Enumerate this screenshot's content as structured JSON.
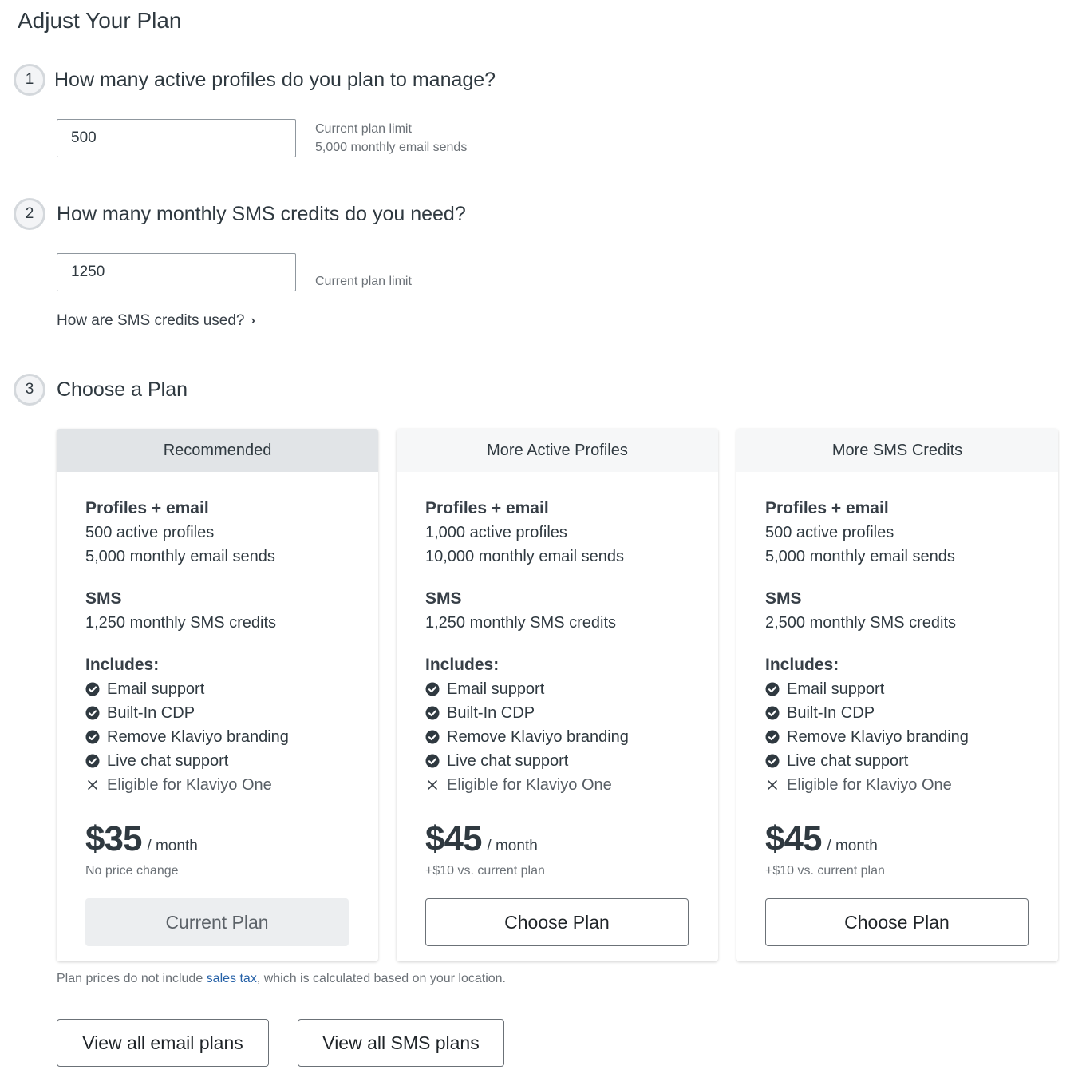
{
  "page": {
    "title": "Adjust Your Plan"
  },
  "steps": [
    {
      "number": "1",
      "title": "How many active profiles do you plan to manage?"
    },
    {
      "number": "2",
      "title": "How many monthly SMS credits do you need?"
    },
    {
      "number": "3",
      "title": "Choose a Plan"
    }
  ],
  "profiles_input": {
    "value": "500",
    "hint_line1": "Current plan limit",
    "hint_line2": "5,000 monthly email sends"
  },
  "sms_input": {
    "value": "1250",
    "hint_line1": "Current plan limit"
  },
  "sms_link": {
    "label": "How are SMS credits used?",
    "icon": "chevron-right-icon",
    "glyph": "›"
  },
  "plans": [
    {
      "header": "Recommended",
      "profiles_title": "Profiles + email",
      "profiles": "500 active profiles",
      "email_sends": "5,000 monthly email sends",
      "sms_title": "SMS",
      "sms_credits": "1,250 monthly SMS credits",
      "includes_title": "Includes:",
      "features": [
        {
          "label": "Email support",
          "included": true
        },
        {
          "label": "Built-In CDP",
          "included": true
        },
        {
          "label": "Remove Klaviyo branding",
          "included": true
        },
        {
          "label": "Live chat support",
          "included": true
        },
        {
          "label": "Eligible for Klaviyo One",
          "included": false
        }
      ],
      "price": "$35",
      "period": "/ month",
      "price_note": "No price change",
      "button": "Current Plan"
    },
    {
      "header": "More Active Profiles",
      "profiles_title": "Profiles + email",
      "profiles": "1,000 active profiles",
      "email_sends": "10,000 monthly email sends",
      "sms_title": "SMS",
      "sms_credits": "1,250 monthly SMS credits",
      "includes_title": "Includes:",
      "features": [
        {
          "label": "Email support",
          "included": true
        },
        {
          "label": "Built-In CDP",
          "included": true
        },
        {
          "label": "Remove Klaviyo branding",
          "included": true
        },
        {
          "label": "Live chat support",
          "included": true
        },
        {
          "label": "Eligible for Klaviyo One",
          "included": false
        }
      ],
      "price": "$45",
      "period": "/ month",
      "price_note": "+$10 vs. current plan",
      "button": "Choose Plan"
    },
    {
      "header": "More SMS Credits",
      "profiles_title": "Profiles + email",
      "profiles": "500 active profiles",
      "email_sends": "5,000 monthly email sends",
      "sms_title": "SMS",
      "sms_credits": "2,500 monthly SMS credits",
      "includes_title": "Includes:",
      "features": [
        {
          "label": "Email support",
          "included": true
        },
        {
          "label": "Built-In CDP",
          "included": true
        },
        {
          "label": "Remove Klaviyo branding",
          "included": true
        },
        {
          "label": "Live chat support",
          "included": true
        },
        {
          "label": "Eligible for Klaviyo One",
          "included": false
        }
      ],
      "price": "$45",
      "period": "/ month",
      "price_note": "+$10 vs. current plan",
      "button": "Choose Plan"
    }
  ],
  "tax_note": {
    "before": "Plan prices do not include ",
    "link": "sales tax",
    "after": ", which is calculated based on your location."
  },
  "footer_buttons": {
    "email_plans": "View all email plans",
    "sms_plans": "View all SMS plans"
  },
  "colors": {
    "link": "#2762a8",
    "recommended_header": "#e1e4e7",
    "header": "#f6f7f8",
    "text": "#2f3940"
  }
}
